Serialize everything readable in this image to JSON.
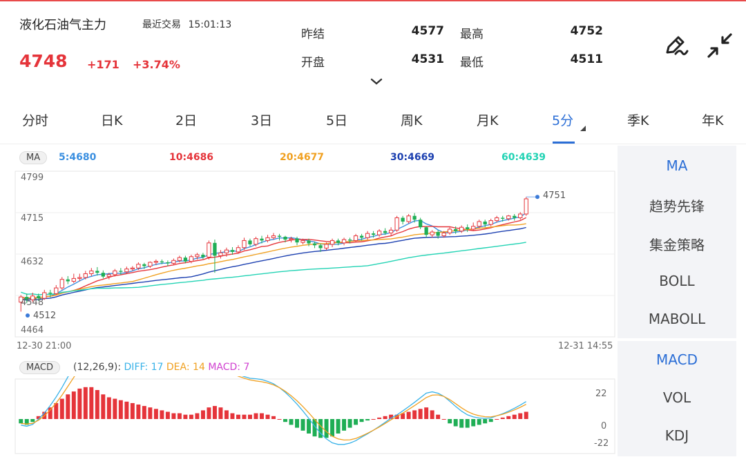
{
  "header": {
    "name": "液化石油气主力",
    "recent_label": "最近交易",
    "time": "15:01:13",
    "price": "4748",
    "change": "+171",
    "change_pct": "+3.74%",
    "quotes": [
      {
        "label": "昨结",
        "value": "4577"
      },
      {
        "label": "最高",
        "value": "4752"
      },
      {
        "label": "开盘",
        "value": "4531"
      },
      {
        "label": "最低",
        "value": "4511"
      }
    ],
    "icons": [
      "edit-pen-icon",
      "collapse-arrows-icon",
      "chevron-down-icon"
    ]
  },
  "tabs": [
    {
      "label": "分时"
    },
    {
      "label": "日K"
    },
    {
      "label": "2日"
    },
    {
      "label": "3日"
    },
    {
      "label": "5日"
    },
    {
      "label": "周K"
    },
    {
      "label": "月K"
    },
    {
      "label": "5分",
      "active": true
    },
    {
      "label": "季K"
    },
    {
      "label": "年K"
    }
  ],
  "ma_bar": {
    "chip": "MA",
    "values": [
      {
        "label": "5:4680",
        "color": "#3a8fe0"
      },
      {
        "label": "10:4686",
        "color": "#e5343a"
      },
      {
        "label": "20:4677",
        "color": "#f0a020"
      },
      {
        "label": "30:4669",
        "color": "#1b3fb0"
      },
      {
        "label": "60:4639",
        "color": "#22d3b4"
      }
    ]
  },
  "price_axis": [
    "4799",
    "4715",
    "4632",
    "4548",
    "4464"
  ],
  "marker_high": "4751",
  "marker_low": "4512",
  "time_axis": {
    "start": "12-30 21:00",
    "end": "12-31 14:55"
  },
  "macd_bar": {
    "chip": "MACD",
    "params": "(12,26,9):",
    "diff": {
      "label": "DIFF: 17",
      "color": "#38b2e8"
    },
    "dea": {
      "label": "DEA: 14",
      "color": "#f0a020"
    },
    "macd": {
      "label": "MACD: 7",
      "color": "#d040d0"
    }
  },
  "macd_axis": [
    "22",
    "0",
    "-22"
  ],
  "side_panel": {
    "main": [
      {
        "label": "MA",
        "active": true
      },
      {
        "label": "趋势先锋"
      },
      {
        "label": "集金策略"
      },
      {
        "label": "BOLL"
      },
      {
        "label": "MABOLL"
      }
    ],
    "sub": [
      {
        "label": "MACD",
        "active": true
      },
      {
        "label": "VOL"
      },
      {
        "label": "KDJ"
      }
    ]
  },
  "colors": {
    "up": "#e5343a",
    "down": "#1fae55",
    "accent": "#2b6ed6"
  },
  "chart_data": {
    "type": "candlestick",
    "ylim": [
      4464,
      4799
    ],
    "candles": [
      [
        4530,
        4541,
        4510,
        4545
      ],
      [
        4541,
        4535,
        4528,
        4548
      ],
      [
        4535,
        4543,
        4530,
        4550
      ],
      [
        4543,
        4538,
        4532,
        4548
      ],
      [
        4538,
        4550,
        4535,
        4556
      ],
      [
        4550,
        4548,
        4540,
        4556
      ],
      [
        4548,
        4560,
        4545,
        4566
      ],
      [
        4560,
        4578,
        4556,
        4583
      ],
      [
        4578,
        4574,
        4568,
        4585
      ],
      [
        4574,
        4580,
        4570,
        4590
      ],
      [
        4580,
        4582,
        4574,
        4590
      ],
      [
        4582,
        4590,
        4578,
        4596
      ],
      [
        4590,
        4596,
        4585,
        4602
      ],
      [
        4596,
        4592,
        4586,
        4604
      ],
      [
        4592,
        4584,
        4580,
        4597
      ],
      [
        4584,
        4588,
        4578,
        4592
      ],
      [
        4588,
        4596,
        4584,
        4600
      ],
      [
        4596,
        4594,
        4588,
        4602
      ],
      [
        4594,
        4600,
        4590,
        4605
      ],
      [
        4600,
        4602,
        4596,
        4606
      ],
      [
        4602,
        4610,
        4598,
        4614
      ],
      [
        4610,
        4606,
        4600,
        4613
      ],
      [
        4606,
        4614,
        4602,
        4616
      ],
      [
        4614,
        4616,
        4608,
        4620
      ],
      [
        4616,
        4614,
        4610,
        4620
      ],
      [
        4614,
        4612,
        4606,
        4618
      ],
      [
        4612,
        4618,
        4608,
        4622
      ],
      [
        4618,
        4624,
        4614,
        4628
      ],
      [
        4624,
        4616,
        4612,
        4628
      ],
      [
        4616,
        4626,
        4612,
        4630
      ],
      [
        4626,
        4630,
        4620,
        4634
      ],
      [
        4630,
        4625,
        4621,
        4634
      ],
      [
        4625,
        4655,
        4620,
        4660
      ],
      [
        4655,
        4628,
        4592,
        4662
      ],
      [
        4628,
        4634,
        4622,
        4640
      ],
      [
        4634,
        4640,
        4626,
        4645
      ],
      [
        4640,
        4636,
        4630,
        4646
      ],
      [
        4636,
        4645,
        4632,
        4650
      ],
      [
        4645,
        4660,
        4640,
        4666
      ],
      [
        4660,
        4652,
        4648,
        4664
      ],
      [
        4652,
        4664,
        4648,
        4668
      ],
      [
        4664,
        4660,
        4654,
        4670
      ],
      [
        4660,
        4666,
        4656,
        4672
      ],
      [
        4666,
        4670,
        4662,
        4676
      ],
      [
        4670,
        4668,
        4660,
        4674
      ],
      [
        4668,
        4662,
        4656,
        4670
      ],
      [
        4662,
        4664,
        4656,
        4668
      ],
      [
        4664,
        4656,
        4650,
        4668
      ],
      [
        4656,
        4660,
        4652,
        4664
      ],
      [
        4660,
        4654,
        4648,
        4664
      ],
      [
        4654,
        4650,
        4644,
        4658
      ],
      [
        4650,
        4644,
        4636,
        4654
      ],
      [
        4644,
        4652,
        4640,
        4656
      ],
      [
        4652,
        4660,
        4646,
        4664
      ],
      [
        4660,
        4655,
        4650,
        4664
      ],
      [
        4655,
        4662,
        4650,
        4666
      ],
      [
        4662,
        4660,
        4654,
        4666
      ],
      [
        4660,
        4670,
        4656,
        4674
      ],
      [
        4670,
        4666,
        4660,
        4674
      ],
      [
        4666,
        4675,
        4662,
        4680
      ],
      [
        4675,
        4672,
        4666,
        4680
      ],
      [
        4672,
        4680,
        4668,
        4684
      ],
      [
        4680,
        4676,
        4672,
        4686
      ],
      [
        4676,
        4682,
        4670,
        4688
      ],
      [
        4682,
        4708,
        4678,
        4712
      ],
      [
        4708,
        4700,
        4694,
        4712
      ],
      [
        4700,
        4712,
        4696,
        4716
      ],
      [
        4712,
        4704,
        4698,
        4718
      ],
      [
        4704,
        4688,
        4684,
        4708
      ],
      [
        4688,
        4672,
        4666,
        4690
      ],
      [
        4672,
        4678,
        4666,
        4682
      ],
      [
        4678,
        4670,
        4664,
        4682
      ],
      [
        4670,
        4676,
        4666,
        4680
      ],
      [
        4676,
        4684,
        4672,
        4688
      ],
      [
        4684,
        4680,
        4674,
        4690
      ],
      [
        4680,
        4688,
        4676,
        4692
      ],
      [
        4688,
        4684,
        4678,
        4694
      ],
      [
        4684,
        4690,
        4680,
        4698
      ],
      [
        4690,
        4700,
        4686,
        4704
      ],
      [
        4700,
        4694,
        4688,
        4704
      ],
      [
        4694,
        4702,
        4690,
        4706
      ],
      [
        4702,
        4708,
        4698,
        4712
      ],
      [
        4708,
        4706,
        4700,
        4712
      ],
      [
        4706,
        4712,
        4702,
        4714
      ],
      [
        4712,
        4708,
        4702,
        4716
      ],
      [
        4708,
        4716,
        4704,
        4720
      ],
      [
        4716,
        4748,
        4712,
        4752
      ]
    ],
    "macd_hist": [
      -3,
      -4,
      -2,
      2,
      5,
      8,
      11,
      14,
      17,
      19,
      21,
      22,
      22,
      20,
      17,
      15,
      14,
      13,
      12,
      11,
      10,
      9,
      8,
      7,
      6,
      5,
      4,
      4,
      3,
      3,
      4,
      6,
      8,
      9,
      8,
      6,
      4,
      3,
      3,
      3,
      4,
      4,
      3,
      2,
      0,
      -2,
      -4,
      -6,
      -8,
      -10,
      -12,
      -13,
      -13,
      -12,
      -10,
      -8,
      -6,
      -4,
      -2,
      -1,
      0,
      1,
      2,
      3,
      3,
      4,
      5,
      6,
      7,
      8,
      6,
      3,
      0,
      -3,
      -5,
      -6,
      -6,
      -5,
      -4,
      -3,
      -2,
      0,
      1,
      2,
      3,
      4,
      5
    ],
    "macd_ylim": [
      -22,
      22
    ]
  }
}
